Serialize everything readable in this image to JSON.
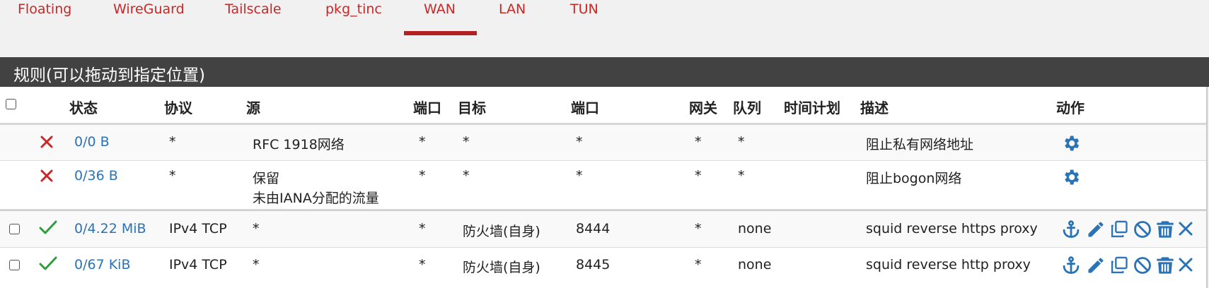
{
  "tabs": [
    {
      "label": "Floating"
    },
    {
      "label": "WireGuard"
    },
    {
      "label": "Tailscale"
    },
    {
      "label": "pkg_tinc"
    },
    {
      "label": "WAN",
      "active": true
    },
    {
      "label": "LAN"
    },
    {
      "label": "TUN"
    }
  ],
  "panel": {
    "title": "规则(可以拖动到指定位置)"
  },
  "columns": {
    "status": "状态",
    "protocol": "协议",
    "source": "源",
    "source_port": "端口",
    "destination": "目标",
    "dest_port": "端口",
    "gateway": "网关",
    "queue": "队列",
    "schedule": "时间计划",
    "description": "描述",
    "actions": "动作"
  },
  "rows": [
    {
      "status": "0/0 B",
      "protocol": "*",
      "source": "RFC 1918网络",
      "source_port": "*",
      "destination": "*",
      "dest_port": "*",
      "gateway": "*",
      "queue": "*",
      "description": "阻止私有网络地址"
    },
    {
      "status": "0/36 B",
      "protocol": "*",
      "source": "保留",
      "source_line2": "未由IANA分配的流量",
      "source_port": "*",
      "destination": "*",
      "dest_port": "*",
      "gateway": "*",
      "queue": "*",
      "description": "阻止bogon网络"
    },
    {
      "status": "0/4.22 MiB",
      "protocol": "IPv4 TCP",
      "source": "*",
      "source_port": "*",
      "destination": "防火墙(自身)",
      "dest_port": "8444",
      "gateway": "*",
      "queue": "none",
      "description": "squid reverse https proxy"
    },
    {
      "status": "0/67 KiB",
      "protocol": "IPv4 TCP",
      "source": "*",
      "source_port": "*",
      "destination": "防火墙(自身)",
      "dest_port": "8445",
      "gateway": "*",
      "queue": "none",
      "description": "squid reverse http proxy"
    }
  ],
  "colors": {
    "accent": "#b22222",
    "link": "#2a73b6",
    "block": "#c62828",
    "pass": "#2e9e3f",
    "header_bg": "#424242"
  }
}
